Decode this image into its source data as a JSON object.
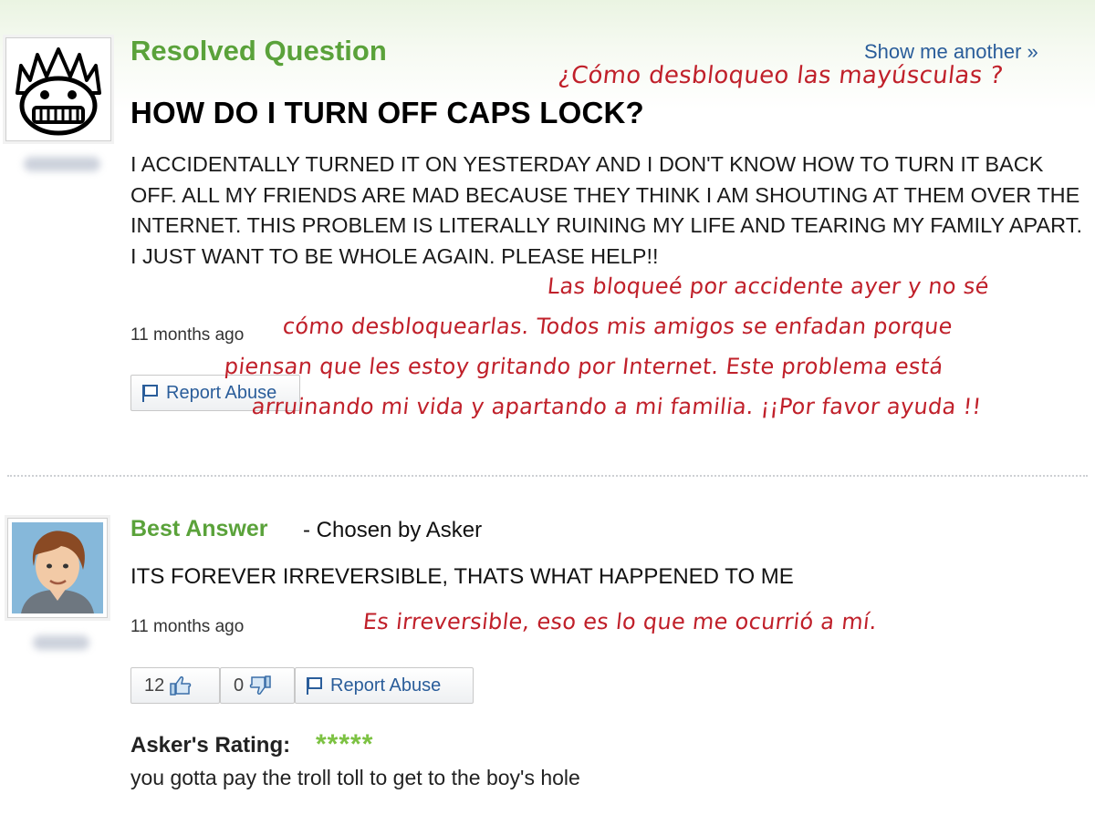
{
  "question": {
    "status": "Resolved Question",
    "show_another": "Show me another »",
    "title": "HOW DO I TURN OFF CAPS LOCK?",
    "body": "I ACCIDENTALLY TURNED IT ON YESTERDAY AND I DON'T KNOW HOW TO TURN IT BACK OFF. ALL MY FRIENDS ARE MAD BECAUSE THEY THINK I AM SHOUTING AT THEM OVER THE INTERNET. THIS PROBLEM IS LITERALLY RUINING MY LIFE AND TEARING MY FAMILY APART. I JUST WANT TO BE WHOLE AGAIN. PLEASE HELP!!",
    "time": "11 months ago",
    "report_label": "Report Abuse"
  },
  "translations": {
    "title": "¿Cómo desbloqueo las mayúsculas ?",
    "body_lines": [
      "Las bloqueé por accidente ayer y no sé",
      "cómo desbloquearlas. Todos mis amigos se enfadan porque",
      "piensan que les estoy gritando por Internet. Este problema está",
      "arruinando mi vida y apartando a mi familia. ¡¡Por favor ayuda !!"
    ],
    "answer": "Es irreversible, eso es lo que me ocurrió a mí."
  },
  "answer": {
    "label": "Best Answer",
    "chosen_by": "- Chosen by Asker",
    "body": "ITS FOREVER IRREVERSIBLE, THATS WHAT HAPPENED TO ME",
    "time": "11 months ago",
    "thumbs_up": "12",
    "thumbs_down": "0",
    "report_label": "Report Abuse"
  },
  "rating": {
    "label": "Asker's Rating:",
    "stars": "*****",
    "comment": "you gotta pay the troll toll to get to the boy's hole"
  },
  "colors": {
    "green": "#5aa23a",
    "link": "#2a5d9a",
    "annotation": "#c0202a"
  }
}
